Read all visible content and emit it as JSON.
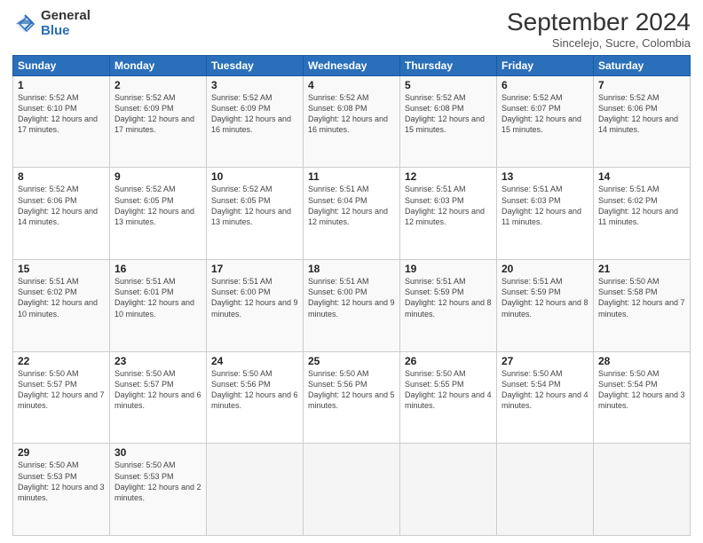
{
  "logo": {
    "general": "General",
    "blue": "Blue"
  },
  "title": "September 2024",
  "subtitle": "Sincelejo, Sucre, Colombia",
  "headers": [
    "Sunday",
    "Monday",
    "Tuesday",
    "Wednesday",
    "Thursday",
    "Friday",
    "Saturday"
  ],
  "weeks": [
    [
      {
        "day": "1",
        "sunrise": "5:52 AM",
        "sunset": "6:10 PM",
        "daylight": "12 hours and 17 minutes."
      },
      {
        "day": "2",
        "sunrise": "5:52 AM",
        "sunset": "6:09 PM",
        "daylight": "12 hours and 17 minutes."
      },
      {
        "day": "3",
        "sunrise": "5:52 AM",
        "sunset": "6:09 PM",
        "daylight": "12 hours and 16 minutes."
      },
      {
        "day": "4",
        "sunrise": "5:52 AM",
        "sunset": "6:08 PM",
        "daylight": "12 hours and 16 minutes."
      },
      {
        "day": "5",
        "sunrise": "5:52 AM",
        "sunset": "6:08 PM",
        "daylight": "12 hours and 15 minutes."
      },
      {
        "day": "6",
        "sunrise": "5:52 AM",
        "sunset": "6:07 PM",
        "daylight": "12 hours and 15 minutes."
      },
      {
        "day": "7",
        "sunrise": "5:52 AM",
        "sunset": "6:06 PM",
        "daylight": "12 hours and 14 minutes."
      }
    ],
    [
      {
        "day": "8",
        "sunrise": "5:52 AM",
        "sunset": "6:06 PM",
        "daylight": "12 hours and 14 minutes."
      },
      {
        "day": "9",
        "sunrise": "5:52 AM",
        "sunset": "6:05 PM",
        "daylight": "12 hours and 13 minutes."
      },
      {
        "day": "10",
        "sunrise": "5:52 AM",
        "sunset": "6:05 PM",
        "daylight": "12 hours and 13 minutes."
      },
      {
        "day": "11",
        "sunrise": "5:51 AM",
        "sunset": "6:04 PM",
        "daylight": "12 hours and 12 minutes."
      },
      {
        "day": "12",
        "sunrise": "5:51 AM",
        "sunset": "6:03 PM",
        "daylight": "12 hours and 12 minutes."
      },
      {
        "day": "13",
        "sunrise": "5:51 AM",
        "sunset": "6:03 PM",
        "daylight": "12 hours and 11 minutes."
      },
      {
        "day": "14",
        "sunrise": "5:51 AM",
        "sunset": "6:02 PM",
        "daylight": "12 hours and 11 minutes."
      }
    ],
    [
      {
        "day": "15",
        "sunrise": "5:51 AM",
        "sunset": "6:02 PM",
        "daylight": "12 hours and 10 minutes."
      },
      {
        "day": "16",
        "sunrise": "5:51 AM",
        "sunset": "6:01 PM",
        "daylight": "12 hours and 10 minutes."
      },
      {
        "day": "17",
        "sunrise": "5:51 AM",
        "sunset": "6:00 PM",
        "daylight": "12 hours and 9 minutes."
      },
      {
        "day": "18",
        "sunrise": "5:51 AM",
        "sunset": "6:00 PM",
        "daylight": "12 hours and 9 minutes."
      },
      {
        "day": "19",
        "sunrise": "5:51 AM",
        "sunset": "5:59 PM",
        "daylight": "12 hours and 8 minutes."
      },
      {
        "day": "20",
        "sunrise": "5:51 AM",
        "sunset": "5:59 PM",
        "daylight": "12 hours and 8 minutes."
      },
      {
        "day": "21",
        "sunrise": "5:50 AM",
        "sunset": "5:58 PM",
        "daylight": "12 hours and 7 minutes."
      }
    ],
    [
      {
        "day": "22",
        "sunrise": "5:50 AM",
        "sunset": "5:57 PM",
        "daylight": "12 hours and 7 minutes."
      },
      {
        "day": "23",
        "sunrise": "5:50 AM",
        "sunset": "5:57 PM",
        "daylight": "12 hours and 6 minutes."
      },
      {
        "day": "24",
        "sunrise": "5:50 AM",
        "sunset": "5:56 PM",
        "daylight": "12 hours and 6 minutes."
      },
      {
        "day": "25",
        "sunrise": "5:50 AM",
        "sunset": "5:56 PM",
        "daylight": "12 hours and 5 minutes."
      },
      {
        "day": "26",
        "sunrise": "5:50 AM",
        "sunset": "5:55 PM",
        "daylight": "12 hours and 4 minutes."
      },
      {
        "day": "27",
        "sunrise": "5:50 AM",
        "sunset": "5:54 PM",
        "daylight": "12 hours and 4 minutes."
      },
      {
        "day": "28",
        "sunrise": "5:50 AM",
        "sunset": "5:54 PM",
        "daylight": "12 hours and 3 minutes."
      }
    ],
    [
      {
        "day": "29",
        "sunrise": "5:50 AM",
        "sunset": "5:53 PM",
        "daylight": "12 hours and 3 minutes."
      },
      {
        "day": "30",
        "sunrise": "5:50 AM",
        "sunset": "5:53 PM",
        "daylight": "12 hours and 2 minutes."
      },
      null,
      null,
      null,
      null,
      null
    ]
  ]
}
